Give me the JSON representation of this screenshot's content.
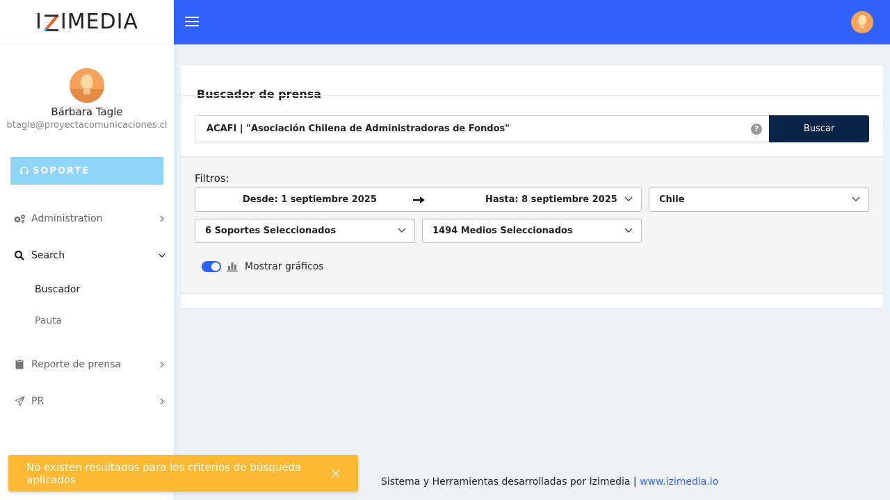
{
  "brand": {
    "logo_prefix": "I",
    "logo_suffix": "IMEDIA"
  },
  "user": {
    "name": "Bárbara Tagle",
    "email": "btagle@proyectacomunicaciones.cl"
  },
  "sidebar": {
    "support_label": "SOPORTE",
    "items": [
      {
        "label": "Administration",
        "icon": "gears-icon",
        "expanded": false
      },
      {
        "label": "Search",
        "icon": "search-icon",
        "expanded": true,
        "children": [
          {
            "label": "Buscador",
            "current": true
          },
          {
            "label": "Pauta",
            "current": false
          }
        ]
      },
      {
        "label": "Reporte de prensa",
        "icon": "clipboard-icon",
        "expanded": false
      },
      {
        "label": "PR",
        "icon": "paper-plane-icon",
        "expanded": false
      }
    ]
  },
  "card": {
    "title": "Buscador de prensa",
    "search": {
      "value": "ACAFI | \"Asociación Chilena de Administradoras de Fondos\"",
      "button_label": "Buscar"
    },
    "filters": {
      "label": "Filtros:",
      "date_from": "Desde: 1 septiembre 2025",
      "date_to": "Hasta: 8 septiembre 2025",
      "country": "Chile",
      "soportes": "6 Soportes Seleccionados",
      "medios": "1494 Medios Seleccionados",
      "show_charts_label": "Mostrar gráficos",
      "show_charts_on": true
    }
  },
  "footer": {
    "text": "Sistema y Herramientas desarrolladas por Izimedia | ",
    "link": "www.izimedia.io"
  },
  "toast": {
    "message": "No existen resultados para los criterios de búsqueda aplicados"
  },
  "colors": {
    "topbar": "#2f62fb",
    "button": "#0c234a",
    "support": "#8fd5f8",
    "toast": "#fdb934",
    "avatar": "#f7a25a"
  }
}
